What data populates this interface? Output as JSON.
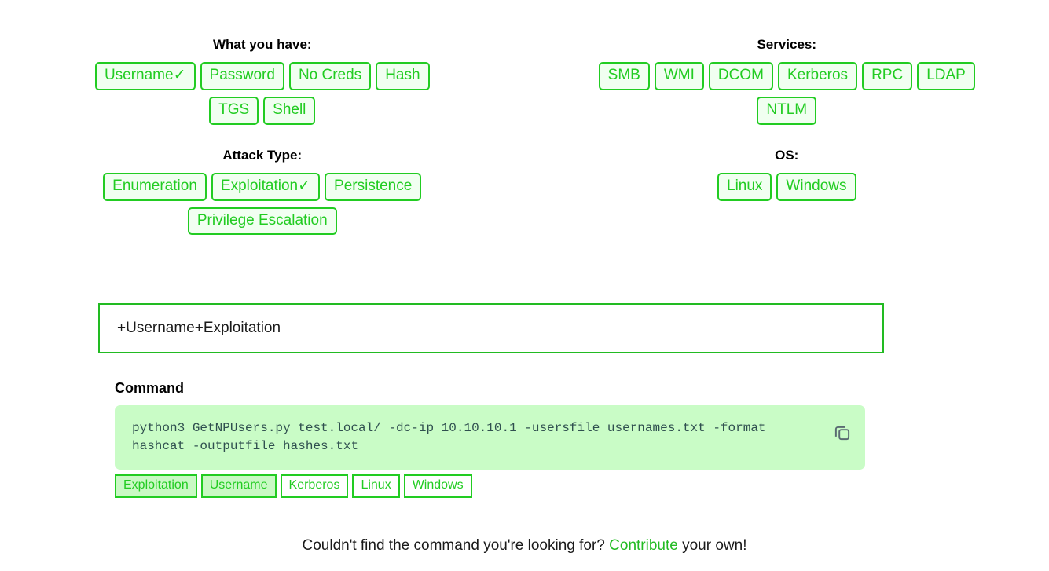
{
  "groups": [
    {
      "id": "what-you-have",
      "title": "What you have:",
      "rows": [
        [
          {
            "label": "Username✓",
            "name": "username",
            "selected": true
          },
          {
            "label": "Password",
            "name": "password",
            "selected": false
          },
          {
            "label": "No Creds",
            "name": "no-creds",
            "selected": false
          },
          {
            "label": "Hash",
            "name": "hash",
            "selected": false
          }
        ],
        [
          {
            "label": "TGS",
            "name": "tgs",
            "selected": false
          },
          {
            "label": "Shell",
            "name": "shell",
            "selected": false
          }
        ]
      ]
    },
    {
      "id": "services",
      "title": "Services:",
      "rows": [
        [
          {
            "label": "SMB",
            "name": "smb",
            "selected": false
          },
          {
            "label": "WMI",
            "name": "wmi",
            "selected": false
          },
          {
            "label": "DCOM",
            "name": "dcom",
            "selected": false
          },
          {
            "label": "Kerberos",
            "name": "kerberos",
            "selected": false
          },
          {
            "label": "RPC",
            "name": "rpc",
            "selected": false
          },
          {
            "label": "LDAP",
            "name": "ldap",
            "selected": false
          }
        ],
        [
          {
            "label": "NTLM",
            "name": "ntlm",
            "selected": false
          }
        ]
      ]
    },
    {
      "id": "attack-type",
      "title": "Attack Type:",
      "rows": [
        [
          {
            "label": "Enumeration",
            "name": "enumeration",
            "selected": false
          },
          {
            "label": "Exploitation✓",
            "name": "exploitation",
            "selected": true
          },
          {
            "label": "Persistence",
            "name": "persistence",
            "selected": false
          }
        ],
        [
          {
            "label": "Privilege Escalation",
            "name": "privilege-escalation",
            "selected": false
          }
        ]
      ]
    },
    {
      "id": "os",
      "title": "OS:",
      "rows": [
        [
          {
            "label": "Linux",
            "name": "linux",
            "selected": false
          },
          {
            "label": "Windows",
            "name": "windows",
            "selected": false
          }
        ]
      ]
    }
  ],
  "filter_bar": {
    "value": "+Username+Exploitation"
  },
  "command": {
    "heading": "Command",
    "text": "python3 GetNPUsers.py test.local/ -dc-ip 10.10.10.1 -usersfile usernames.txt -format hashcat -outputfile hashes.txt",
    "copy_icon": "copy-icon",
    "tags": [
      {
        "label": "Exploitation",
        "name": "exploitation",
        "active": true
      },
      {
        "label": "Username",
        "name": "username",
        "active": true
      },
      {
        "label": "Kerberos",
        "name": "kerberos",
        "active": false
      },
      {
        "label": "Linux",
        "name": "linux",
        "active": false
      },
      {
        "label": "Windows",
        "name": "windows",
        "active": false
      }
    ]
  },
  "footer": {
    "before": "Couldn't find the command you're looking for? ",
    "link": "Contribute",
    "after": " your own!"
  },
  "colors": {
    "accent_green": "#22cc22",
    "border_green": "#22bb22",
    "button_fill": "#f1fff1",
    "code_bg": "#c9fcc6",
    "code_text": "#2f4f4f",
    "tag_active_bg": "#c9f9c4",
    "copy_icon": "#5a6b72"
  }
}
